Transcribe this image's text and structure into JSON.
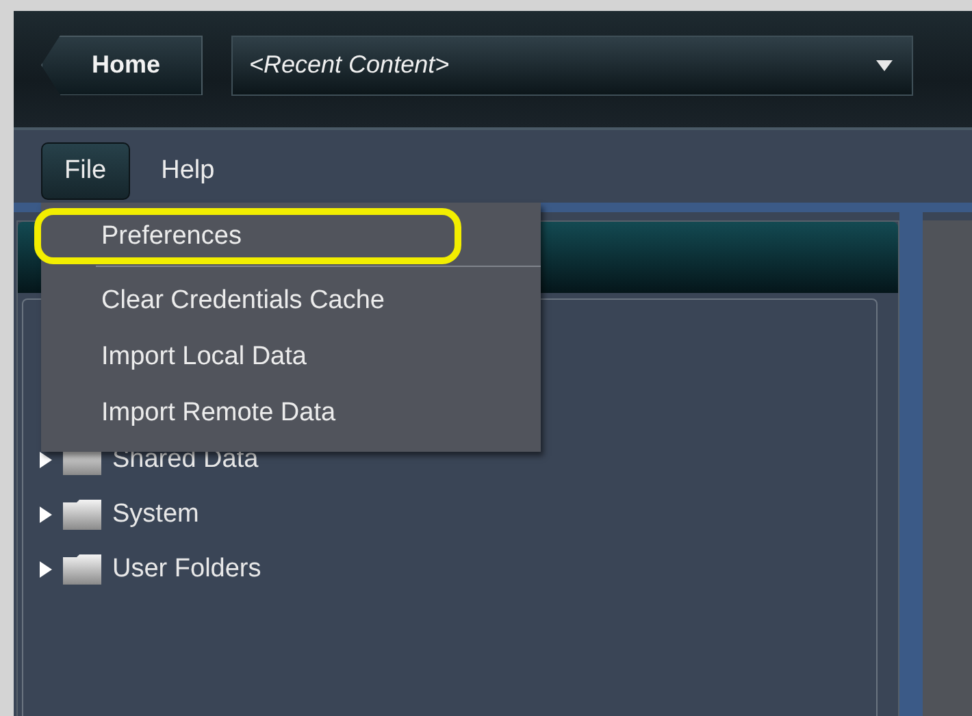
{
  "header": {
    "home_button": "Home",
    "recent_dropdown": {
      "value": "<Recent Content>"
    }
  },
  "menubar": [
    {
      "label": "File",
      "selected": true
    },
    {
      "label": "Help",
      "selected": false
    }
  ],
  "file_menu": [
    {
      "label": "Preferences",
      "highlighted": true,
      "separator_after": true
    },
    {
      "label": "Clear Credentials Cache",
      "highlighted": false,
      "separator_after": false
    },
    {
      "label": "Import Local Data",
      "highlighted": false,
      "separator_after": false
    },
    {
      "label": "Import Remote Data",
      "highlighted": false,
      "separator_after": false
    }
  ],
  "tree": [
    {
      "label": "Shared Data",
      "expanded": false
    },
    {
      "label": "System",
      "expanded": false
    },
    {
      "label": "User Folders",
      "expanded": false
    }
  ]
}
